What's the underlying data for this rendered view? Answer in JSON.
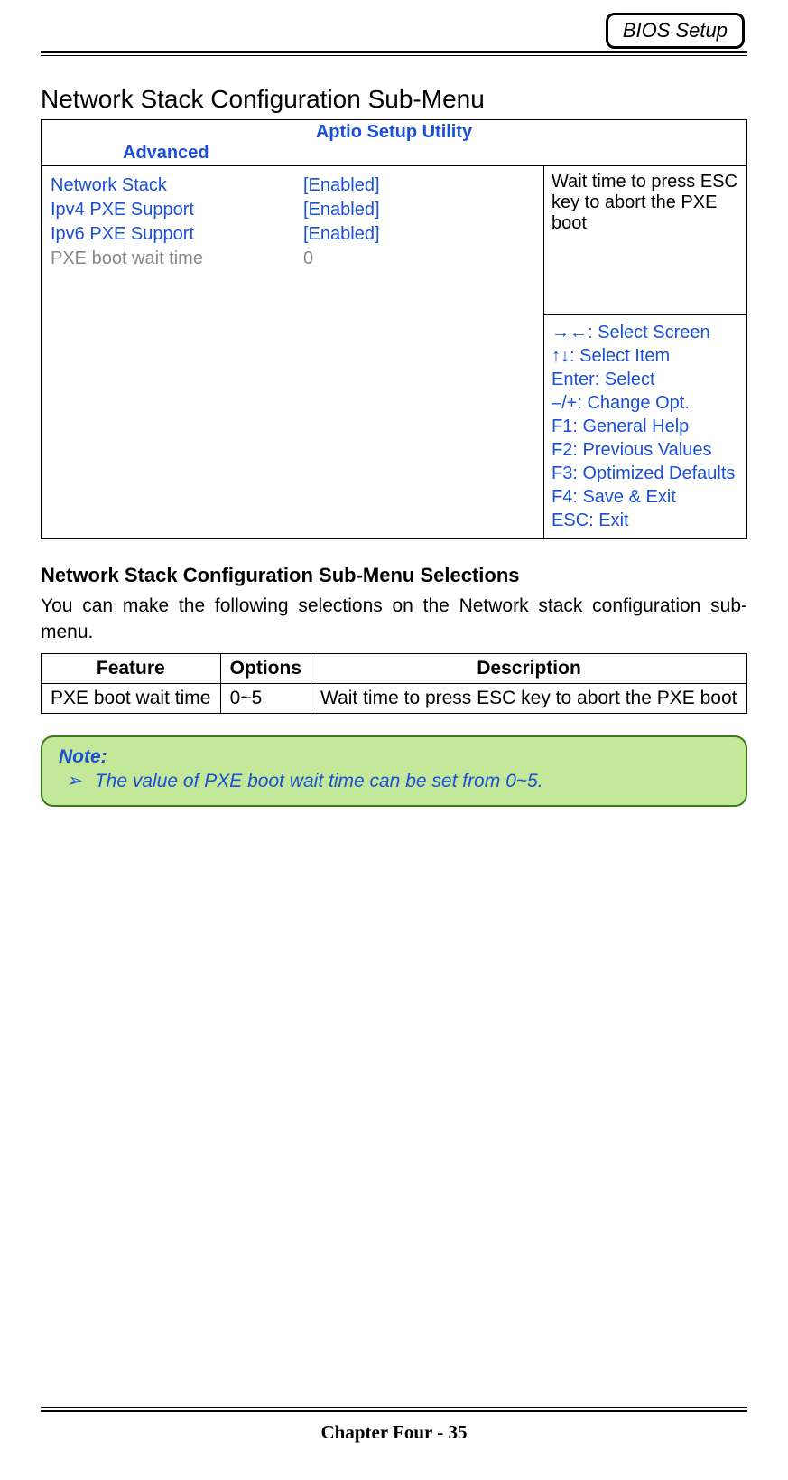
{
  "header": {
    "badge": "BIOS Setup"
  },
  "title": "Network Stack Configuration Sub-Menu",
  "bios": {
    "utility_title": "Aptio Setup Utility",
    "tab": "Advanced",
    "items": [
      {
        "label": "Network Stack",
        "value": "[Enabled]",
        "cls": "blue"
      },
      {
        "label": "Ipv4 PXE Support",
        "value": "[Enabled]",
        "cls": "blue"
      },
      {
        "label": "Ipv6 PXE Support",
        "value": "[Enabled]",
        "cls": "blue"
      },
      {
        "label": "PXE boot wait time",
        "value": "0",
        "cls": "gray"
      }
    ],
    "help_text": "Wait time to press ESC key to abort the PXE boot",
    "nav": [
      "→←: Select Screen",
      "↑↓: Select Item",
      "Enter: Select",
      "–/+: Change Opt.",
      "F1: General Help",
      "F2: Previous Values",
      "F3: Optimized Defaults",
      "F4: Save & Exit",
      "ESC: Exit"
    ]
  },
  "selections": {
    "heading": "Network Stack Configuration Sub-Menu Selections",
    "intro": "You can make the following selections on the Network stack configuration sub-menu.",
    "headers": {
      "feature": "Feature",
      "options": "Options",
      "description": "Description"
    },
    "rows": [
      {
        "feature": "PXE boot wait time",
        "options": "0~5",
        "description": "Wait time to press ESC key to abort the PXE boot"
      }
    ]
  },
  "note": {
    "label": "Note:",
    "bullet": "➢",
    "text": "The value of PXE boot wait time can be set from 0~5."
  },
  "footer": {
    "text": "Chapter Four - 35"
  },
  "chart_data": {
    "type": "table",
    "title": "Network Stack Configuration Sub-Menu Selections",
    "columns": [
      "Feature",
      "Options",
      "Description"
    ],
    "rows": [
      [
        "PXE boot wait time",
        "0~5",
        "Wait time to press ESC key to abort the PXE boot"
      ]
    ]
  }
}
